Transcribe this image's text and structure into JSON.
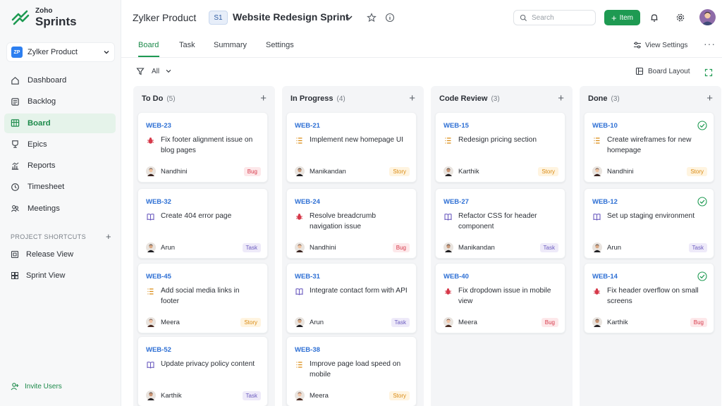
{
  "app": {
    "brand_small": "Zoho",
    "brand": "Sprints"
  },
  "sidebar": {
    "project": {
      "badge": "ZP",
      "name": "Zylker Product"
    },
    "items": [
      {
        "label": "Dashboard",
        "icon": "home-icon"
      },
      {
        "label": "Backlog",
        "icon": "backlog-icon"
      },
      {
        "label": "Board",
        "icon": "board-icon",
        "active": true
      },
      {
        "label": "Epics",
        "icon": "epics-icon"
      },
      {
        "label": "Reports",
        "icon": "reports-icon"
      },
      {
        "label": "Timesheet",
        "icon": "clock-icon"
      },
      {
        "label": "Meetings",
        "icon": "meetings-icon"
      }
    ],
    "shortcuts_title": "PROJECT SHORTCUTS",
    "shortcuts": [
      {
        "label": "Release View",
        "icon": "release-icon"
      },
      {
        "label": "Sprint View",
        "icon": "sprint-icon"
      }
    ],
    "invite_label": "Invite Users"
  },
  "header": {
    "product": "Zylker Product",
    "sprint_badge": "S1",
    "sprint_title": "Website Redesign Sprint",
    "search_placeholder": "Search",
    "add_label": "Item"
  },
  "tabs": [
    {
      "label": "Board",
      "active": true
    },
    {
      "label": "Task"
    },
    {
      "label": "Summary"
    },
    {
      "label": "Settings"
    }
  ],
  "view_settings_label": "View Settings",
  "filter_label": "All",
  "board_layout_label": "Board Layout",
  "colors": {
    "accent": "#1e9a52",
    "link": "#2d6fd4",
    "bug": "#d6394a",
    "story": "#d98a12",
    "task": "#6b5bbf"
  },
  "columns": [
    {
      "title": "To Do",
      "count": "(5)",
      "cards": [
        {
          "key": "WEB-23",
          "title": "Fix footer alignment issue on blog pages",
          "assignee": "Nandhini",
          "tag": "Bug",
          "type": "bug"
        },
        {
          "key": "WEB-32",
          "title": "Create 404 error page",
          "assignee": "Arun",
          "tag": "Task",
          "type": "task"
        },
        {
          "key": "WEB-45",
          "title": "Add social media links in footer",
          "assignee": "Meera",
          "tag": "Story",
          "type": "story"
        },
        {
          "key": "WEB-52",
          "title": "Update privacy policy content",
          "assignee": "Karthik",
          "tag": "Task",
          "type": "task"
        }
      ]
    },
    {
      "title": "In Progress",
      "count": "(4)",
      "cards": [
        {
          "key": "WEB-21",
          "title": "Implement new homepage UI",
          "assignee": "Manikandan",
          "tag": "Story",
          "type": "story"
        },
        {
          "key": "WEB-24",
          "title": "Resolve breadcrumb navigation issue",
          "assignee": "Nandhini",
          "tag": "Bug",
          "type": "bug"
        },
        {
          "key": "WEB-31",
          "title": "Integrate contact form with API",
          "assignee": "Arun",
          "tag": "Task",
          "type": "task"
        },
        {
          "key": "WEB-38",
          "title": "Improve page load speed on mobile",
          "assignee": "Meera",
          "tag": "Story",
          "type": "story"
        }
      ]
    },
    {
      "title": "Code Review",
      "count": "(3)",
      "cards": [
        {
          "key": "WEB-15",
          "title": "Redesign pricing section",
          "assignee": "Karthik",
          "tag": "Story",
          "type": "story"
        },
        {
          "key": "WEB-27",
          "title": "Refactor CSS for header component",
          "assignee": "Manikandan",
          "tag": "Task",
          "type": "task"
        },
        {
          "key": "WEB-40",
          "title": "Fix dropdown issue in mobile view",
          "assignee": "Meera",
          "tag": "Bug",
          "type": "bug"
        }
      ]
    },
    {
      "title": "Done",
      "count": "(3)",
      "cards": [
        {
          "key": "WEB-10",
          "title": "Create wireframes for new homepage",
          "assignee": "Nandhini",
          "tag": "Story",
          "type": "story",
          "done": true
        },
        {
          "key": "WEB-12",
          "title": "Set up staging environment",
          "assignee": "Arun",
          "tag": "Task",
          "type": "task",
          "done": true
        },
        {
          "key": "WEB-14",
          "title": "Fix header overflow on small screens",
          "assignee": "Karthik",
          "tag": "Bug",
          "type": "bug",
          "done": true
        }
      ]
    }
  ]
}
